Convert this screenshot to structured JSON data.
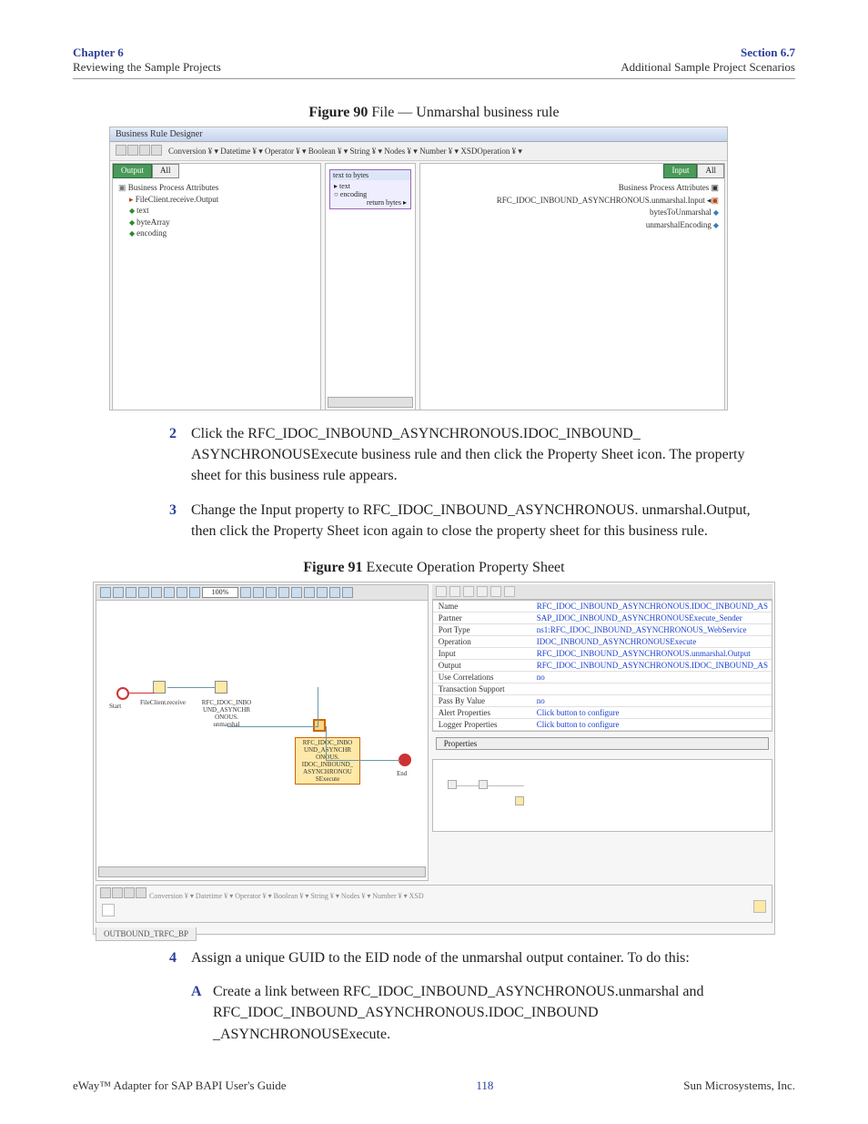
{
  "header": {
    "chapter": "Chapter 6",
    "left_sub": "Reviewing the Sample Projects",
    "section": "Section 6.7",
    "right_sub": "Additional Sample Project Scenarios"
  },
  "figure90": {
    "caption_bold": "Figure 90",
    "caption_rest": "   File — Unmarshal business rule",
    "titlebar": "Business Rule Designer",
    "toolbar_text": "Conversion ¥ ▾   Datetime ¥ ▾   Operator ¥ ▾   Boolean ¥ ▾   String ¥ ▾   Nodes ¥ ▾   Number ¥ ▾   XSDOperation ¥ ▾",
    "left": {
      "btn1": "Output",
      "btn2": "All",
      "root": "Business Process Attributes",
      "n1": "FileClient.receive.Output",
      "a1": "text",
      "a2": "byteArray",
      "a3": "encoding"
    },
    "mid": {
      "box_title": "text to bytes",
      "r1": "text",
      "r2": "encoding",
      "r3": "return bytes"
    },
    "right": {
      "btn1": "Input",
      "btn2": "All",
      "root": "Business Process Attributes",
      "n1": "RFC_IDOC_INBOUND_ASYNCHRONOUS.unmarshal.Input",
      "a1": "bytesToUnmarshal",
      "a2": "unmarshalEncoding"
    }
  },
  "steps": {
    "s2": "Click the RFC_IDOC_INBOUND_ASYNCHRONOUS.IDOC_INBOUND_ ASYNCHRONOUSExecute business rule and then click the Property Sheet icon. The property sheet for this business rule appears.",
    "s3": "Change the Input property to RFC_IDOC_INBOUND_ASYNCHRONOUS. unmarshal.Output, then click the Property Sheet icon again to close the property sheet for this business rule.",
    "s4": "Assign a unique GUID to the EID node of the unmarshal output container. To do this:",
    "sA": "Create a link between RFC_IDOC_INBOUND_ASYNCHRONOUS.unmarshal and RFC_IDOC_INBOUND_ASYNCHRONOUS.IDOC_INBOUND _ASYNCHRONOUSExecute."
  },
  "figure91": {
    "caption_bold": "Figure 91",
    "caption_rest": "   Execute Operation Property Sheet",
    "zoom": "100%",
    "diagram": {
      "start": "Start",
      "n1": "FileClient.receive",
      "n2": "RFC_IDOC_INBO\nUND_ASYNCHR\nONOUS.\nunmarshal",
      "n3": "RFC_IDOC_INBO\nUND_ASYNCHR\nONOUS.\nIDOC_INBOUND_\nASYNCHRONOU\nSExecute",
      "end": "End"
    },
    "props": [
      {
        "k": "Name",
        "v": "RFC_IDOC_INBOUND_ASYNCHRONOUS.IDOC_INBOUND_AS"
      },
      {
        "k": "Partner",
        "v": "SAP_IDOC_INBOUND_ASYNCHRONOUSExecute_Sender"
      },
      {
        "k": "Port Type",
        "v": "ns1:RFC_IDOC_INBOUND_ASYNCHRONOUS_WebService"
      },
      {
        "k": "Operation",
        "v": "IDOC_INBOUND_ASYNCHRONOUSExecute"
      },
      {
        "k": "Input",
        "v": "RFC_IDOC_INBOUND_ASYNCHRONOUS.unmarshal.Output"
      },
      {
        "k": "Output",
        "v": "RFC_IDOC_INBOUND_ASYNCHRONOUS.IDOC_INBOUND_AS"
      },
      {
        "k": "Use Correlations",
        "v": "no"
      },
      {
        "k": "Transaction Support",
        "v": ""
      },
      {
        "k": "Pass By Value",
        "v": "no"
      },
      {
        "k": "Alert Properties",
        "v": "Click button to configure"
      },
      {
        "k": "Logger Properties",
        "v": "Click button to configure"
      }
    ],
    "prop_button": "Properties",
    "bottom_toolbar": "Conversion ¥ ▾   Datetime ¥ ▾   Operator ¥ ▾   Boolean ¥ ▾   String ¥ ▾   Nodes ¥ ▾   Number ¥ ▾   XSD",
    "tab": "OUTBOUND_TRFC_BP"
  },
  "footer": {
    "left": "eWay™ Adapter for SAP BAPI User's Guide",
    "mid": "118",
    "right": "Sun Microsystems, Inc."
  }
}
